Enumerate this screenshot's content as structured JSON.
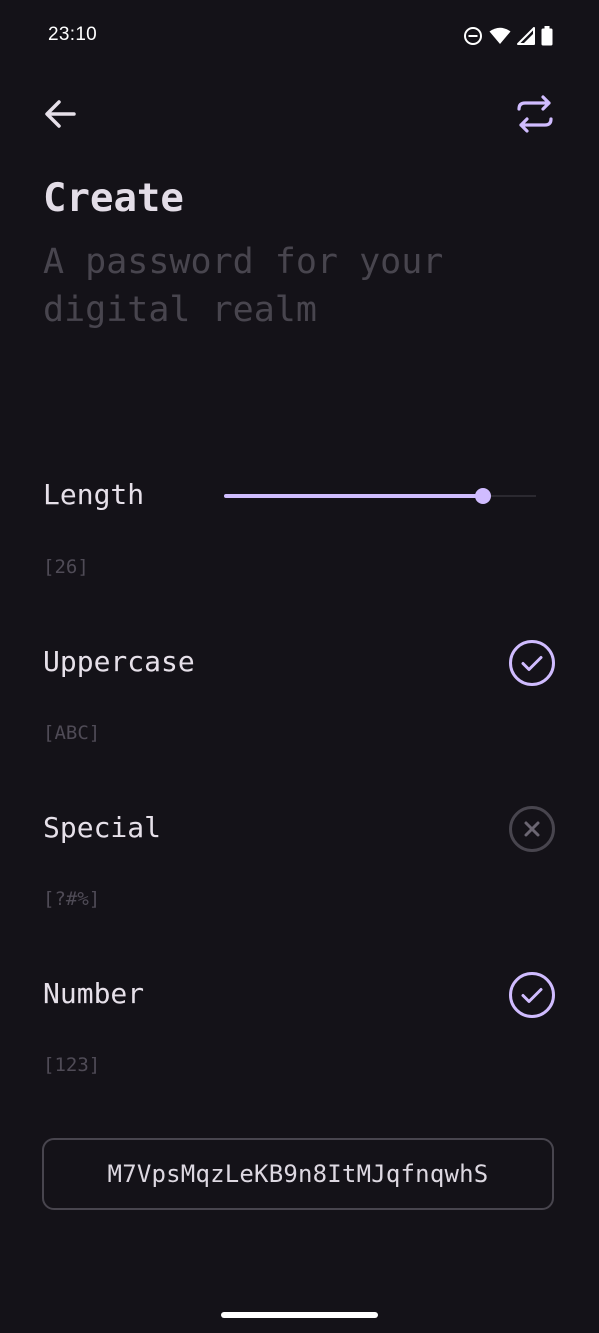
{
  "status_bar": {
    "time": "23:10",
    "icons": [
      "do-not-disturb-icon",
      "wifi-icon",
      "cellular-signal-icon",
      "battery-icon"
    ]
  },
  "app_bar": {
    "back_icon": "arrow-back-icon",
    "refresh_icon": "refresh-icon"
  },
  "header": {
    "title": "Create",
    "subtitle": "A password for your digital realm"
  },
  "options": {
    "length": {
      "label": "Length",
      "hint": "[26]",
      "value": 26,
      "slider_fraction": 0.83
    },
    "uppercase": {
      "label": "Uppercase",
      "hint": "[ABC]",
      "enabled": true,
      "icon": "check-circle-icon"
    },
    "special": {
      "label": "Special",
      "hint": "[?#%]",
      "enabled": false,
      "icon": "cancel-circle-icon"
    },
    "number": {
      "label": "Number",
      "hint": "[123]",
      "enabled": true,
      "icon": "check-circle-icon"
    }
  },
  "password": {
    "value": "M7VpsMqzLeKB9n8ItMJqfnqwhS"
  },
  "colors": {
    "background": "#141218",
    "accent": "#d0bcff",
    "disabled": "#48454e",
    "text": "#e6e0e9",
    "hint": "#4f4b56"
  }
}
